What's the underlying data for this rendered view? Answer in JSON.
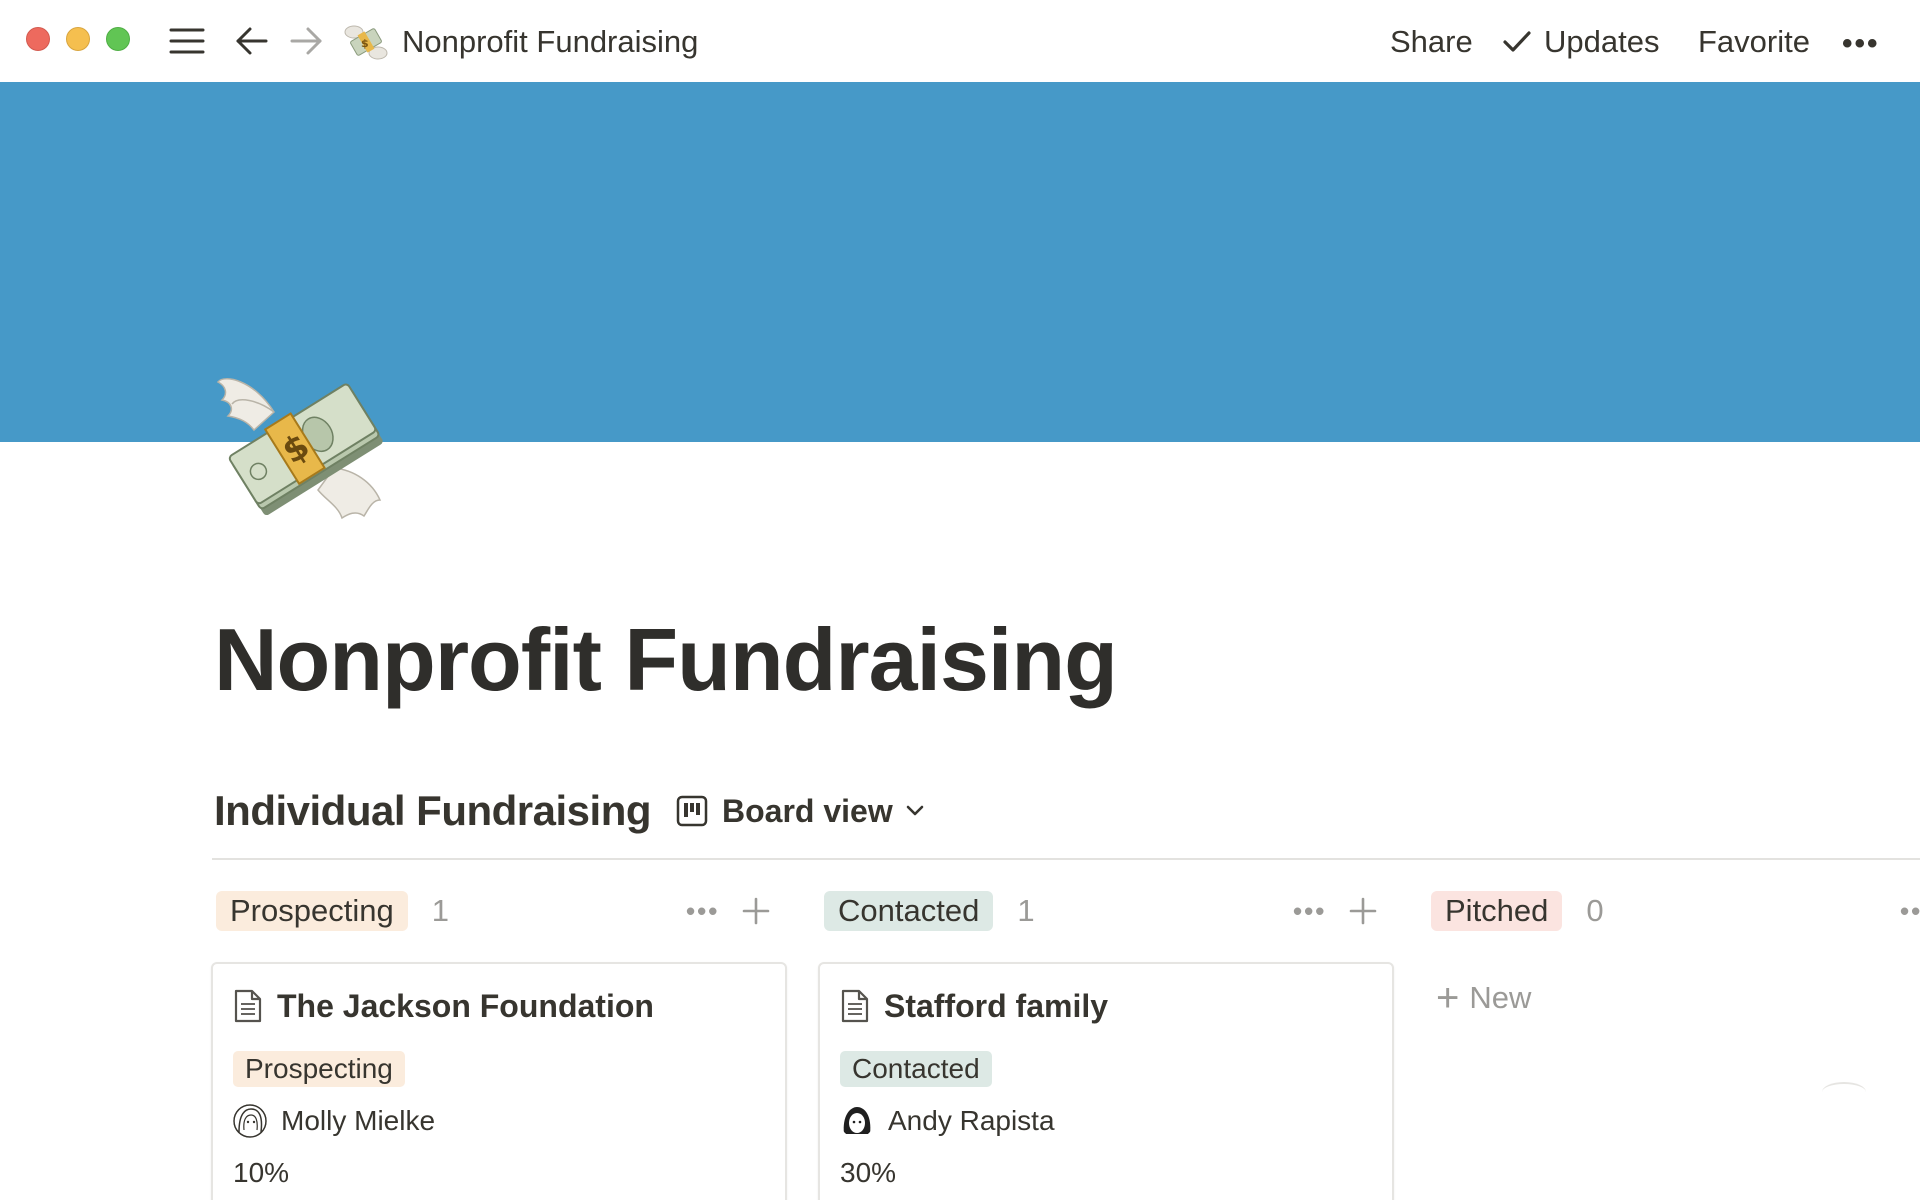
{
  "topbar": {
    "title": "Nonprofit Fundraising",
    "share_label": "Share",
    "updates_label": "Updates",
    "favorite_label": "Favorite",
    "more_label": "•••",
    "icons": [
      "menu-icon",
      "back-arrow-icon",
      "forward-arrow-icon",
      "money-with-wings-icon",
      "checkmark-icon"
    ]
  },
  "cover": {
    "color": "#4699c8"
  },
  "page": {
    "icon": "money-with-wings-icon",
    "title": "Nonprofit Fundraising"
  },
  "database": {
    "title": "Individual Fundraising",
    "view_label": "Board view",
    "columns": [
      {
        "label": "Prospecting",
        "count": "1",
        "color": "#fbecdd",
        "cards": [
          {
            "title": "The Jackson Foundation",
            "status": "Prospecting",
            "person": "Molly Mielke",
            "percent": "10%"
          }
        ]
      },
      {
        "label": "Contacted",
        "count": "1",
        "color": "#dde9e5",
        "cards": [
          {
            "title": "Stafford family",
            "status": "Contacted",
            "person": "Andy Rapista",
            "percent": "30%"
          }
        ]
      },
      {
        "label": "Pitched",
        "count": "0",
        "color": "#fbe4e0",
        "new_label": "New"
      }
    ]
  }
}
